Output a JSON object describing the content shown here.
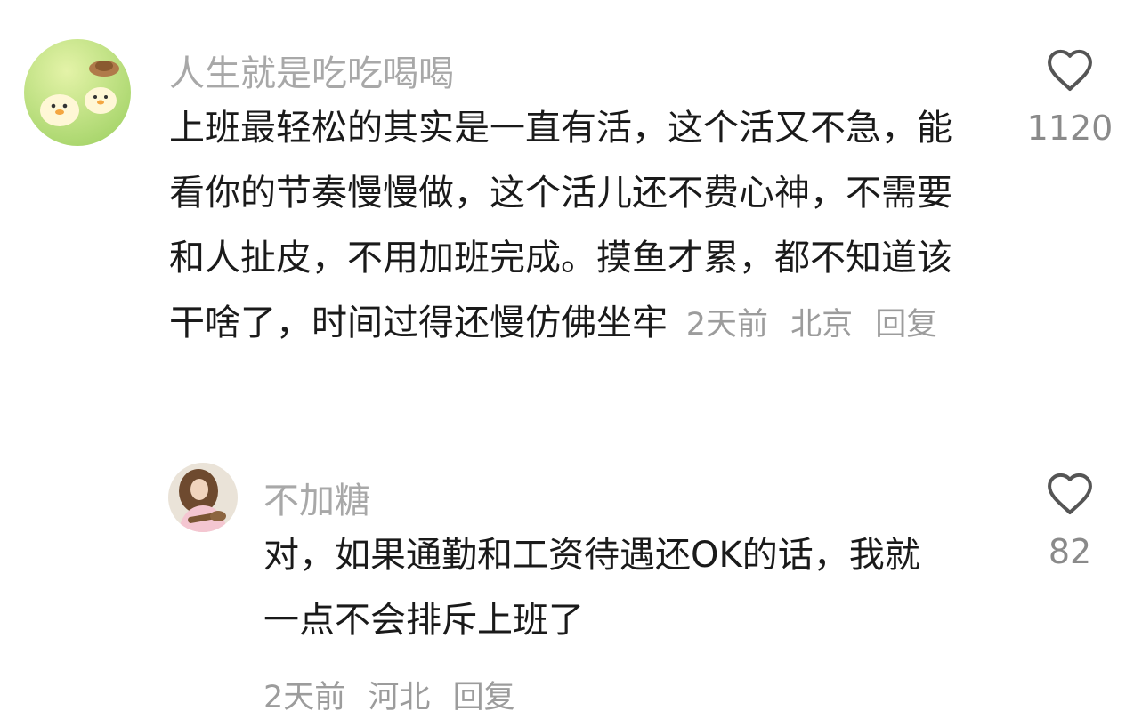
{
  "comments": [
    {
      "username": "人生就是吃吃喝喝",
      "avatar": "duckling-cartoon-avatar",
      "text": "上班最轻松的其实是一直有活，这个活又不急，能看你的节奏慢慢做，这个活儿还不费心神，不需要和人扯皮，不用加班完成。摸鱼才累，都不知道该干啥了，时间过得还慢仿佛坐牢",
      "time": "2天前",
      "location": "北京",
      "reply_label": "回复",
      "likes": "1120",
      "like_icon": "heart-outline-icon"
    },
    {
      "username": "不加糖",
      "avatar": "person-guitar-avatar",
      "text": "对，如果通勤和工资待遇还OK的话，我就一点不会排斥上班了",
      "time": "2天前",
      "location": "河北",
      "reply_label": "回复",
      "likes": "82",
      "like_icon": "heart-outline-icon"
    }
  ],
  "colors": {
    "username": "#a8a8a8",
    "body_text": "#1a1a1a",
    "meta": "#9c9c9c",
    "like_icon": "#555555"
  }
}
